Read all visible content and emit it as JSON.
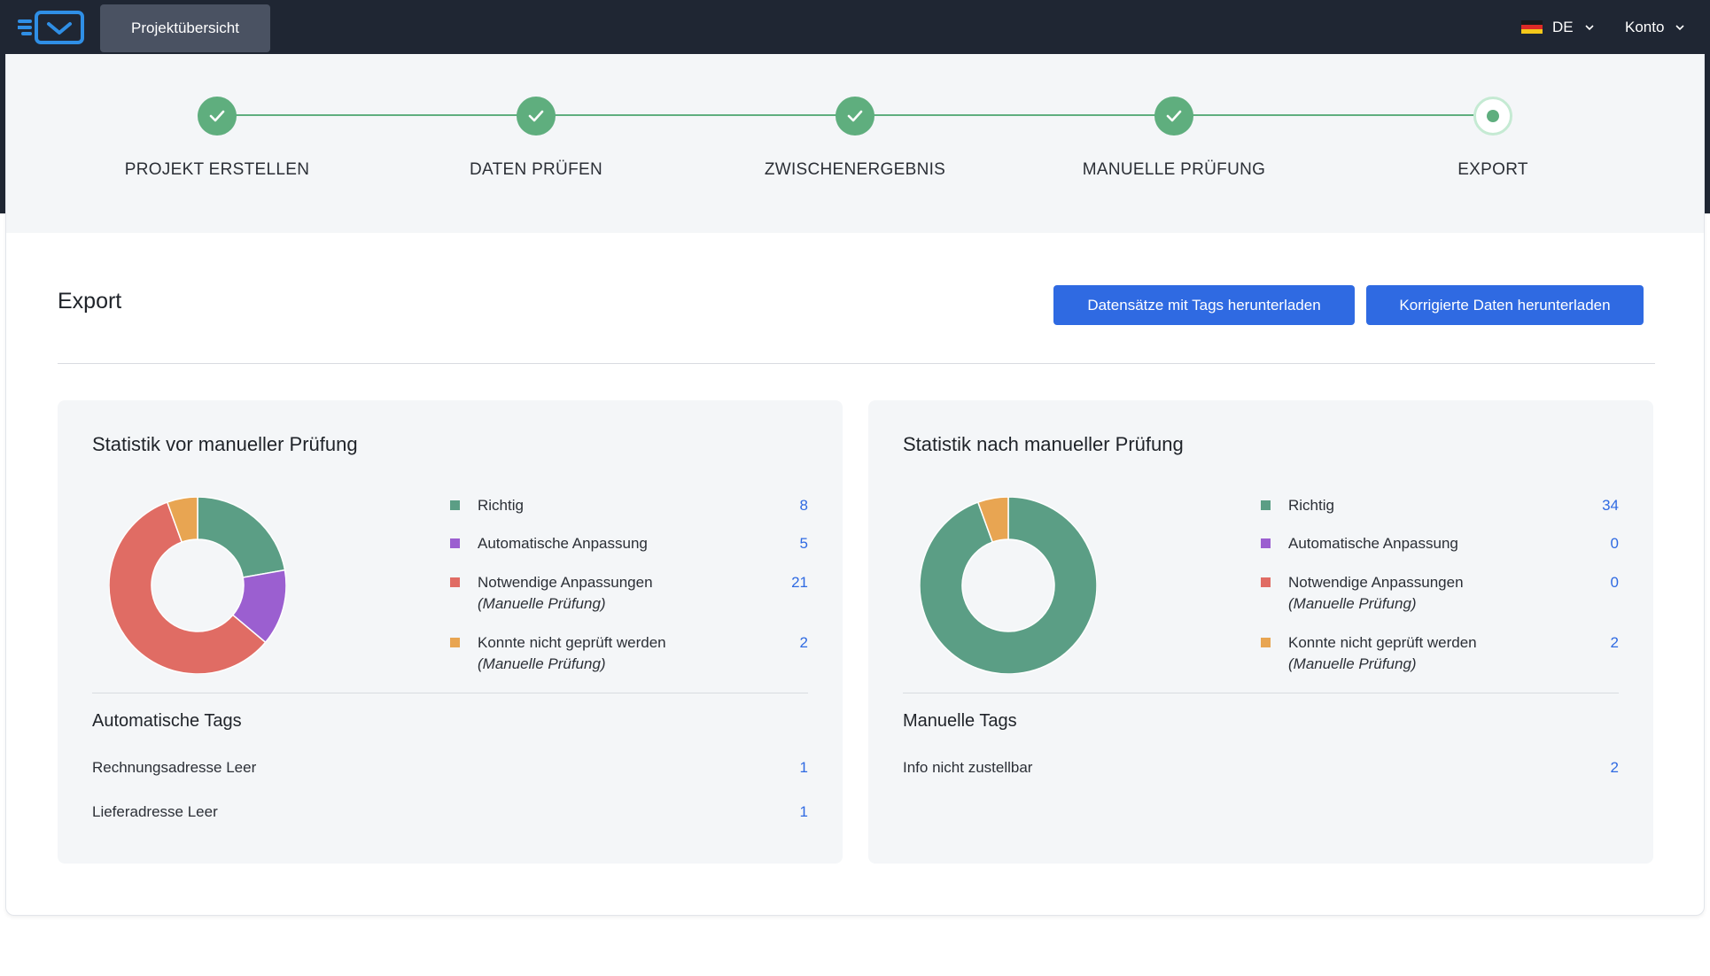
{
  "header": {
    "nav_button": "Projektübersicht",
    "language": "DE",
    "account": "Konto",
    "icons": {
      "logo": "app-logo-icon",
      "flag": "german-flag-icon",
      "chevron": "chevron-down-icon"
    }
  },
  "stepper": {
    "steps": [
      {
        "label": "PROJEKT ERSTELLEN",
        "status": "done"
      },
      {
        "label": "DATEN PRÜFEN",
        "status": "done"
      },
      {
        "label": "ZWISCHENERGEBNIS",
        "status": "done"
      },
      {
        "label": "MANUELLE PRÜFUNG",
        "status": "done"
      },
      {
        "label": "EXPORT",
        "status": "active"
      }
    ]
  },
  "main": {
    "title": "Export",
    "buttons": {
      "download_tags": "Datensätze mit Tags herunterladen",
      "download_corrected": "Korrigierte Daten herunterladen"
    }
  },
  "colors": {
    "richtig": "#5b9e85",
    "automatisch": "#9b5fd0",
    "notwendig": "#e06c64",
    "nicht_geprueft": "#e8a552",
    "accent": "#2f6ae2",
    "step_green": "#5fae7e"
  },
  "panels": [
    {
      "title": "Statistik vor manueller Prüfung",
      "legend": [
        {
          "label": "Richtig",
          "sub": "",
          "value": "8"
        },
        {
          "label": "Automatische Anpassung",
          "sub": "",
          "value": "5"
        },
        {
          "label": "Notwendige Anpassungen",
          "sub": "(Manuelle Prüfung)",
          "value": "21"
        },
        {
          "label": "Konnte nicht geprüft werden",
          "sub": "(Manuelle Prüfung)",
          "value": "2"
        }
      ],
      "tags_title": "Automatische Tags",
      "tags": [
        {
          "label": "Rechnungsadresse Leer",
          "value": "1"
        },
        {
          "label": "Lieferadresse Leer",
          "value": "1"
        }
      ]
    },
    {
      "title": "Statistik nach manueller Prüfung",
      "legend": [
        {
          "label": "Richtig",
          "sub": "",
          "value": "34"
        },
        {
          "label": "Automatische Anpassung",
          "sub": "",
          "value": "0"
        },
        {
          "label": "Notwendige Anpassungen",
          "sub": "(Manuelle Prüfung)",
          "value": "0"
        },
        {
          "label": "Konnte nicht geprüft werden",
          "sub": "(Manuelle Prüfung)",
          "value": "2"
        }
      ],
      "tags_title": "Manuelle Tags",
      "tags": [
        {
          "label": "Info nicht zustellbar",
          "value": "2"
        }
      ]
    }
  ],
  "chart_data": [
    {
      "type": "pie",
      "title": "Statistik vor manueller Prüfung",
      "categories": [
        "Richtig",
        "Automatische Anpassung",
        "Notwendige Anpassungen",
        "Konnte nicht geprüft werden"
      ],
      "values": [
        8,
        5,
        21,
        2
      ],
      "colors": [
        "#5b9e85",
        "#9b5fd0",
        "#e06c64",
        "#e8a552"
      ],
      "donut": true
    },
    {
      "type": "pie",
      "title": "Statistik nach manueller Prüfung",
      "categories": [
        "Richtig",
        "Automatische Anpassung",
        "Notwendige Anpassungen",
        "Konnte nicht geprüft werden"
      ],
      "values": [
        34,
        0,
        0,
        2
      ],
      "colors": [
        "#5b9e85",
        "#9b5fd0",
        "#e06c64",
        "#e8a552"
      ],
      "donut": true
    }
  ]
}
